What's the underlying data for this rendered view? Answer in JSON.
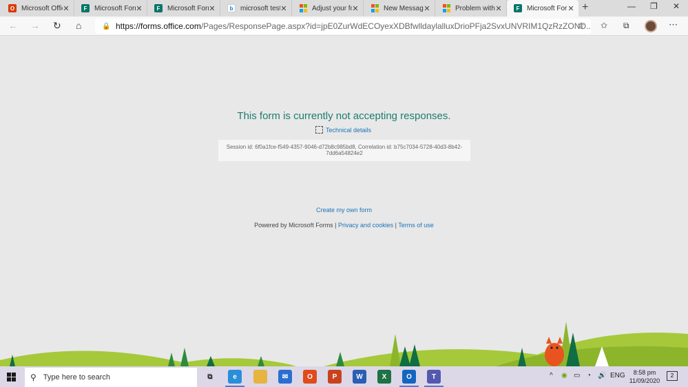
{
  "tabs": [
    {
      "title": "Microsoft Offic",
      "icon": "office-icon"
    },
    {
      "title": "Microsoft Forn",
      "icon": "forms-icon"
    },
    {
      "title": "Microsoft Forn",
      "icon": "forms-icon"
    },
    {
      "title": "microsoft test",
      "icon": "bing-icon"
    },
    {
      "title": "Adjust your fo",
      "icon": "microsoft-logo-icon"
    },
    {
      "title": "New Message",
      "icon": "microsoft-logo-icon"
    },
    {
      "title": "Problem with",
      "icon": "microsoft-logo-icon"
    },
    {
      "title": "Microsoft Forn",
      "icon": "forms-icon"
    }
  ],
  "address": {
    "domain": "https://forms.office.com",
    "path": "/Pages/ResponsePage.aspx?id=jpE0ZurWdECOyexXDBfwlldaylalluxDrioPFja2SvxUNVRIM1QzRzZOND..."
  },
  "content": {
    "notice": "This form is currently not accepting responses.",
    "technical_details": "Technical details",
    "session_info": "Session id: 6f0a1fce-f549-4357-9046-d72b8c985bd8, Correlation id: b75c7034-5728-40d3-8b42-7dd6a54824e2",
    "create_link": "Create my own form",
    "powered_by": "Powered by Microsoft Forms |",
    "privacy_link": "Privacy and cookies",
    "separator": "|",
    "terms_link": "Terms of use"
  },
  "taskbar": {
    "search_placeholder": "Type here to search",
    "language": "ENG",
    "time": "8:58 pm",
    "date": "11/09/2020",
    "notification_count": "2"
  },
  "colors": {
    "accent": "#1b7d6e",
    "link": "#1a73b8",
    "page_bg": "#e8e8e8"
  }
}
